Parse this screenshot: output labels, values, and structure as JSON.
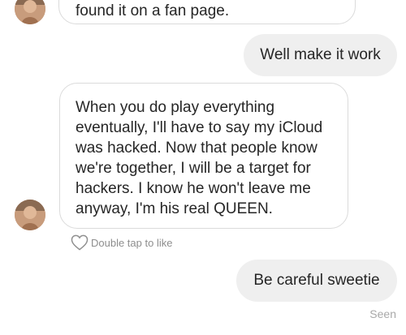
{
  "messages": [
    {
      "from": "them",
      "text": "found it on a fan page."
    },
    {
      "from": "me",
      "text": "Well make it work"
    },
    {
      "from": "them",
      "text": "When you do play everything eventually, I'll have to say my iCloud was hacked. Now that people know we're together, I will be a target for hackers. I know he won't leave me anyway, I'm his real QUEEN."
    },
    {
      "from": "me",
      "text": "Be careful sweetie"
    }
  ],
  "like_hint": {
    "icon": "heart-outline-icon",
    "label": "Double tap to like"
  },
  "seen_label": "Seen",
  "colors": {
    "outgoing_bubble": "#efefef",
    "incoming_border": "#dbdbdb",
    "text": "#262626",
    "muted": "#8e8e8e"
  }
}
